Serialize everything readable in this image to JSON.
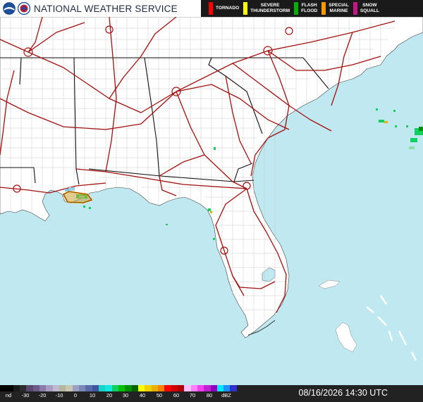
{
  "header": {
    "title": "NATIONAL WEATHER SERVICE"
  },
  "warnings_legend": [
    {
      "label_line1": "TORNADO",
      "label_line2": "",
      "color": "#ff0000"
    },
    {
      "label_line1": "SEVERE",
      "label_line2": "THUNDERSTORM",
      "color": "#ffff00"
    },
    {
      "label_line1": "FLASH",
      "label_line2": "FLOOD",
      "color": "#00b000"
    },
    {
      "label_line1": "SPECIAL",
      "label_line2": "MARINE",
      "color": "#ff9900"
    },
    {
      "label_line1": "SNOW",
      "label_line2": "SQUALL",
      "color": "#c71585"
    }
  ],
  "colors": {
    "water": "#bfe8f0",
    "land": "#ffffff",
    "highways": "#a31010",
    "state_borders": "#000000",
    "county_lines": "#b8b8b8",
    "special_marine_warning": "#ff9900"
  },
  "radar_scale": {
    "labels": [
      "nd",
      "-30",
      "-20",
      "-10",
      "0",
      "10",
      "20",
      "30",
      "40",
      "50",
      "60",
      "70",
      "80",
      "dBZ"
    ],
    "colors": [
      "#000000",
      "#000000",
      "#1a1a1a",
      "#2b2b2b",
      "#5a4870",
      "#6d5a8a",
      "#8a7aa8",
      "#a89cc0",
      "#c0b8d0",
      "#b5b5a0",
      "#c8c8b0",
      "#9aa0c0",
      "#7a88b8",
      "#5a6aa8",
      "#3e56a0",
      "#1ad0c8",
      "#10e8e0",
      "#10d060",
      "#00c000",
      "#009000",
      "#006400",
      "#ffff00",
      "#f0d000",
      "#e8b000",
      "#ff8000",
      "#ff0000",
      "#d00000",
      "#b00000",
      "#ffc0ff",
      "#ff80ff",
      "#f040f0",
      "#c020d0",
      "#9000c0",
      "#00e8ff",
      "#2090ff",
      "#3030d0"
    ]
  },
  "icons": [
    "noaa-logo-icon",
    "nws-logo-icon"
  ],
  "timestamp": "08/16/2026 14:30 UTC"
}
